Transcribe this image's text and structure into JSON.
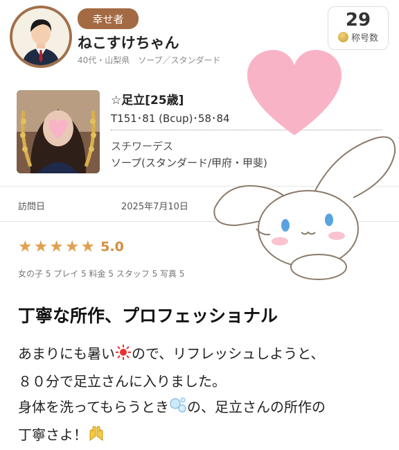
{
  "header": {
    "badge": "幸せ者",
    "user_name": "ねこすけちゃん",
    "user_meta": "40代・山梨県　ソープ／スタンダード",
    "title_count": "29",
    "title_count_label": "称号数"
  },
  "cast": {
    "name": "☆足立[25歳]",
    "measurements": "T151･81 (Bcup)･58･84",
    "job": "スチワーデス",
    "category": "ソープ(スタンダード/甲府・甲斐)"
  },
  "visit": {
    "label": "訪問日",
    "date": "2025年7月10日"
  },
  "rating": {
    "stars": 5,
    "score": "5.0",
    "sub_scores": "女の子 5 プレイ 5 料金 5 スタッフ 5 写真 5"
  },
  "review": {
    "title": "丁寧な所作、プロフェッショナル",
    "line1_a": "あまりにも暑い",
    "line1_b": "ので、リフレッシュしようと、",
    "line2": "８０分で足立さんに入りました。",
    "line3_a": "身体を洗ってもらうとき",
    "line3_b": "の、足立さんの所作の",
    "line4": "丁寧さよ！"
  },
  "colors": {
    "badge": "#a36a43",
    "star": "#e0a04f",
    "score": "#d48e3e",
    "heart": "#f9b3c7"
  }
}
